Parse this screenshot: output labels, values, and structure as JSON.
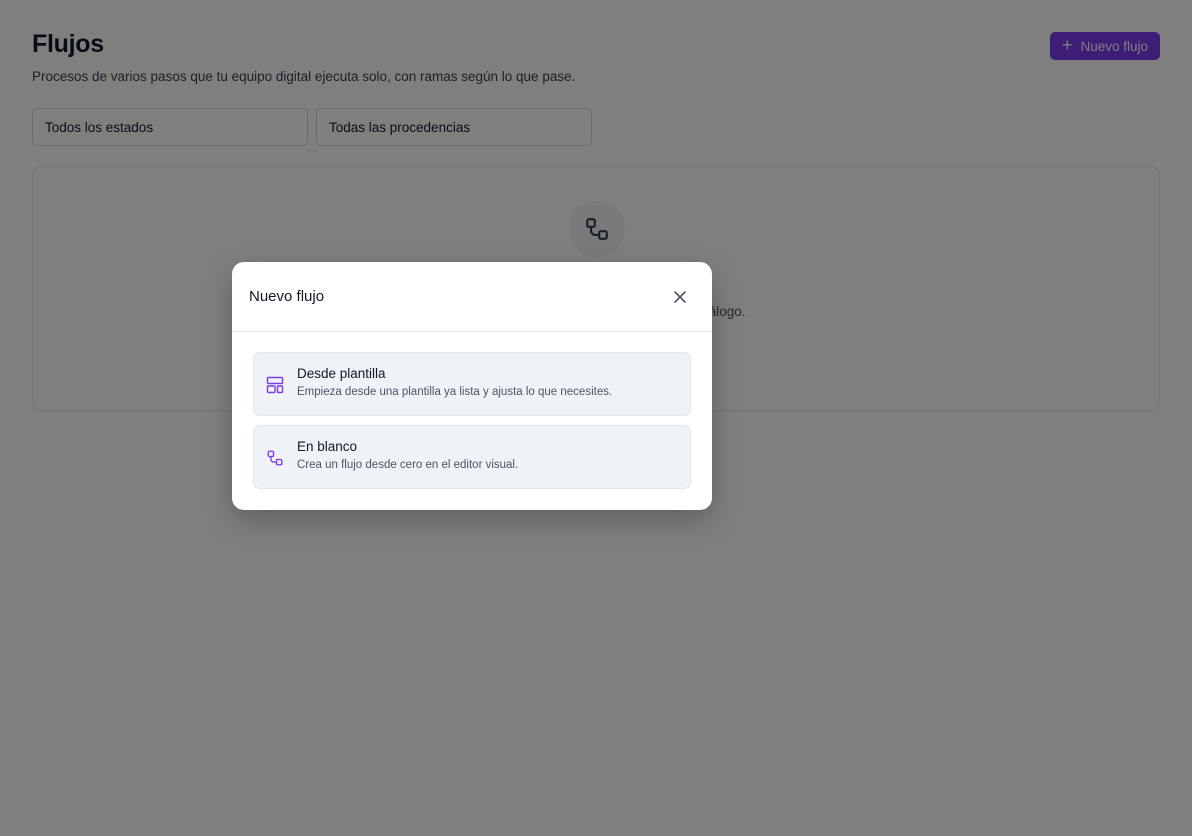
{
  "header": {
    "title": "Flujos",
    "subtitle": "Procesos de varios pasos que tu equipo digital ejecuta solo, con ramas según lo que pase.",
    "new_button_label": "Nuevo flujo",
    "new_button_icon": "plus-icon"
  },
  "filters": {
    "status_value": "Todos los estados",
    "origin_value": "Todas las procedencias"
  },
  "empty_state": {
    "icon": "flow-icon",
    "text_fragment": "tálogo."
  },
  "modal": {
    "title": "Nuevo flujo",
    "close_icon": "close-icon",
    "options": [
      {
        "icon": "template-icon",
        "title": "Desde plantilla",
        "description": "Empieza desde una plantilla ya lista y ajusta lo que necesites."
      },
      {
        "icon": "flow-icon",
        "title": "En blanco",
        "description": "Crea un flujo desde cero en el editor visual."
      }
    ]
  },
  "colors": {
    "accent": "#7c3aed",
    "backdrop": "rgba(0,0,0,0.5)",
    "option_bg": "#eff2f7"
  }
}
